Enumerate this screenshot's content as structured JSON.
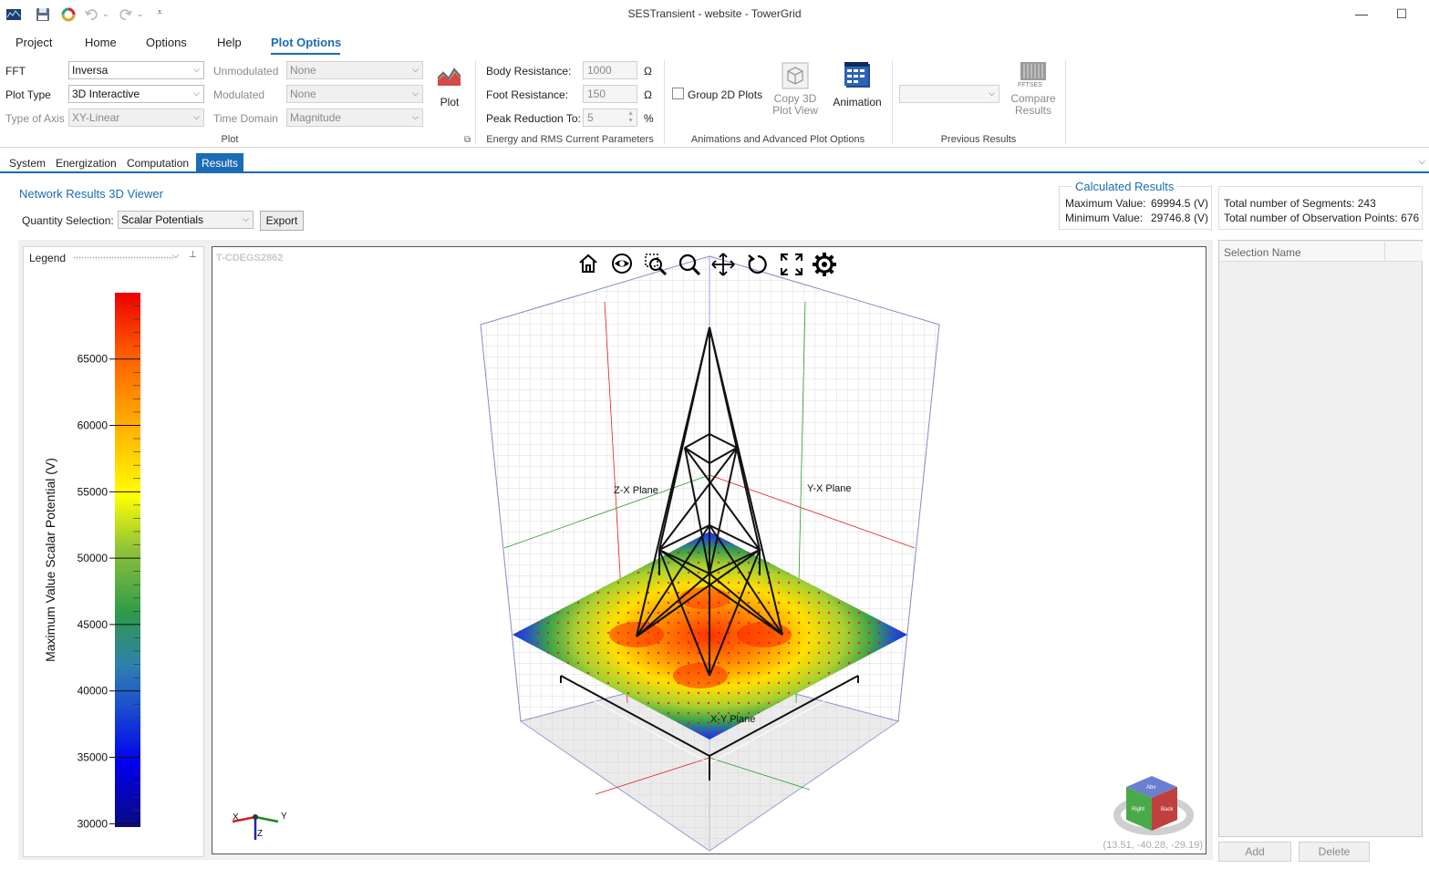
{
  "window": {
    "title": "SESTransient - website - TowerGrid"
  },
  "menu": {
    "items": [
      "Project",
      "Home",
      "Options",
      "Help",
      "Plot Options"
    ]
  },
  "ribbon": {
    "fft_label": "FFT",
    "fft_value": "Inversa",
    "plot_type_label": "Plot Type",
    "plot_type_value": "3D Interactive",
    "axis_type_label": "Type of Axis",
    "axis_type_value": "XY-Linear",
    "unmodulated_label": "Unmodulated",
    "unmodulated_value": "None",
    "modulated_label": "Modulated",
    "modulated_value": "None",
    "time_domain_label": "Time Domain",
    "time_domain_value": "Magnitude",
    "plot_button": "Plot",
    "plot_group": "Plot",
    "body_res_label": "Body Resistance:",
    "body_res_value": "1000",
    "body_res_unit": "Ω",
    "foot_res_label": "Foot Resistance:",
    "foot_res_value": "150",
    "foot_res_unit": "Ω",
    "peak_label": "Peak Reduction To:",
    "peak_value": "5",
    "peak_unit": "%",
    "energy_group": "Energy and RMS Current Parameters",
    "group2d_label": "Group 2D Plots",
    "copy3d_line1": "Copy 3D",
    "copy3d_line2": "Plot View",
    "animation_label": "Animation",
    "anim_group": "Animations and Advanced Plot Options",
    "compare_line1": "Compare",
    "compare_line2": "Results",
    "compare_icon_text": "FFTSES",
    "prev_group": "Previous Results"
  },
  "subtabs": [
    "System",
    "Energization",
    "Computation",
    "Results"
  ],
  "viewer_panel": {
    "title": "Network Results 3D Viewer",
    "quantity_label": "Quantity Selection:",
    "quantity_value": "Scalar Potentials",
    "export_button": "Export"
  },
  "calculated": {
    "title": "Calculated Results",
    "max_label": "Maximum Value:",
    "max_value": "69994.5",
    "max_unit": "(V)",
    "min_label": "Minimum Value:",
    "min_value": "29746.8",
    "min_unit": "(V)"
  },
  "stats": {
    "segments": "Total number of Segments: 243",
    "points": "Total number of Observation Points: 676"
  },
  "legend": {
    "title": "Legend",
    "axis_label": "Maximum Value Scalar Potential  (V)",
    "ticks": [
      "65000",
      "60000",
      "55000",
      "50000",
      "45000",
      "40000",
      "35000",
      "30000"
    ],
    "tick_values": [
      65000,
      60000,
      55000,
      50000,
      45000,
      40000,
      35000,
      30000
    ],
    "range": [
      29746.8,
      69994.5
    ]
  },
  "scene": {
    "watermark": "T-CDEGS2862",
    "zx_label": "Z-X Plane",
    "yx_label": "Y-X Plane",
    "xy_label": "X-Y Plane",
    "coords": "(13.51, -40.28, -29.19)",
    "axis_x": "X",
    "axis_y": "Y",
    "axis_z": "Z",
    "cube_top": "Abv",
    "cube_left": "Right",
    "cube_right": "Back"
  },
  "selection": {
    "column": "Selection Name",
    "add_button": "Add",
    "delete_button": "Delete"
  },
  "colors": {
    "accent": "#1b6cb5"
  }
}
